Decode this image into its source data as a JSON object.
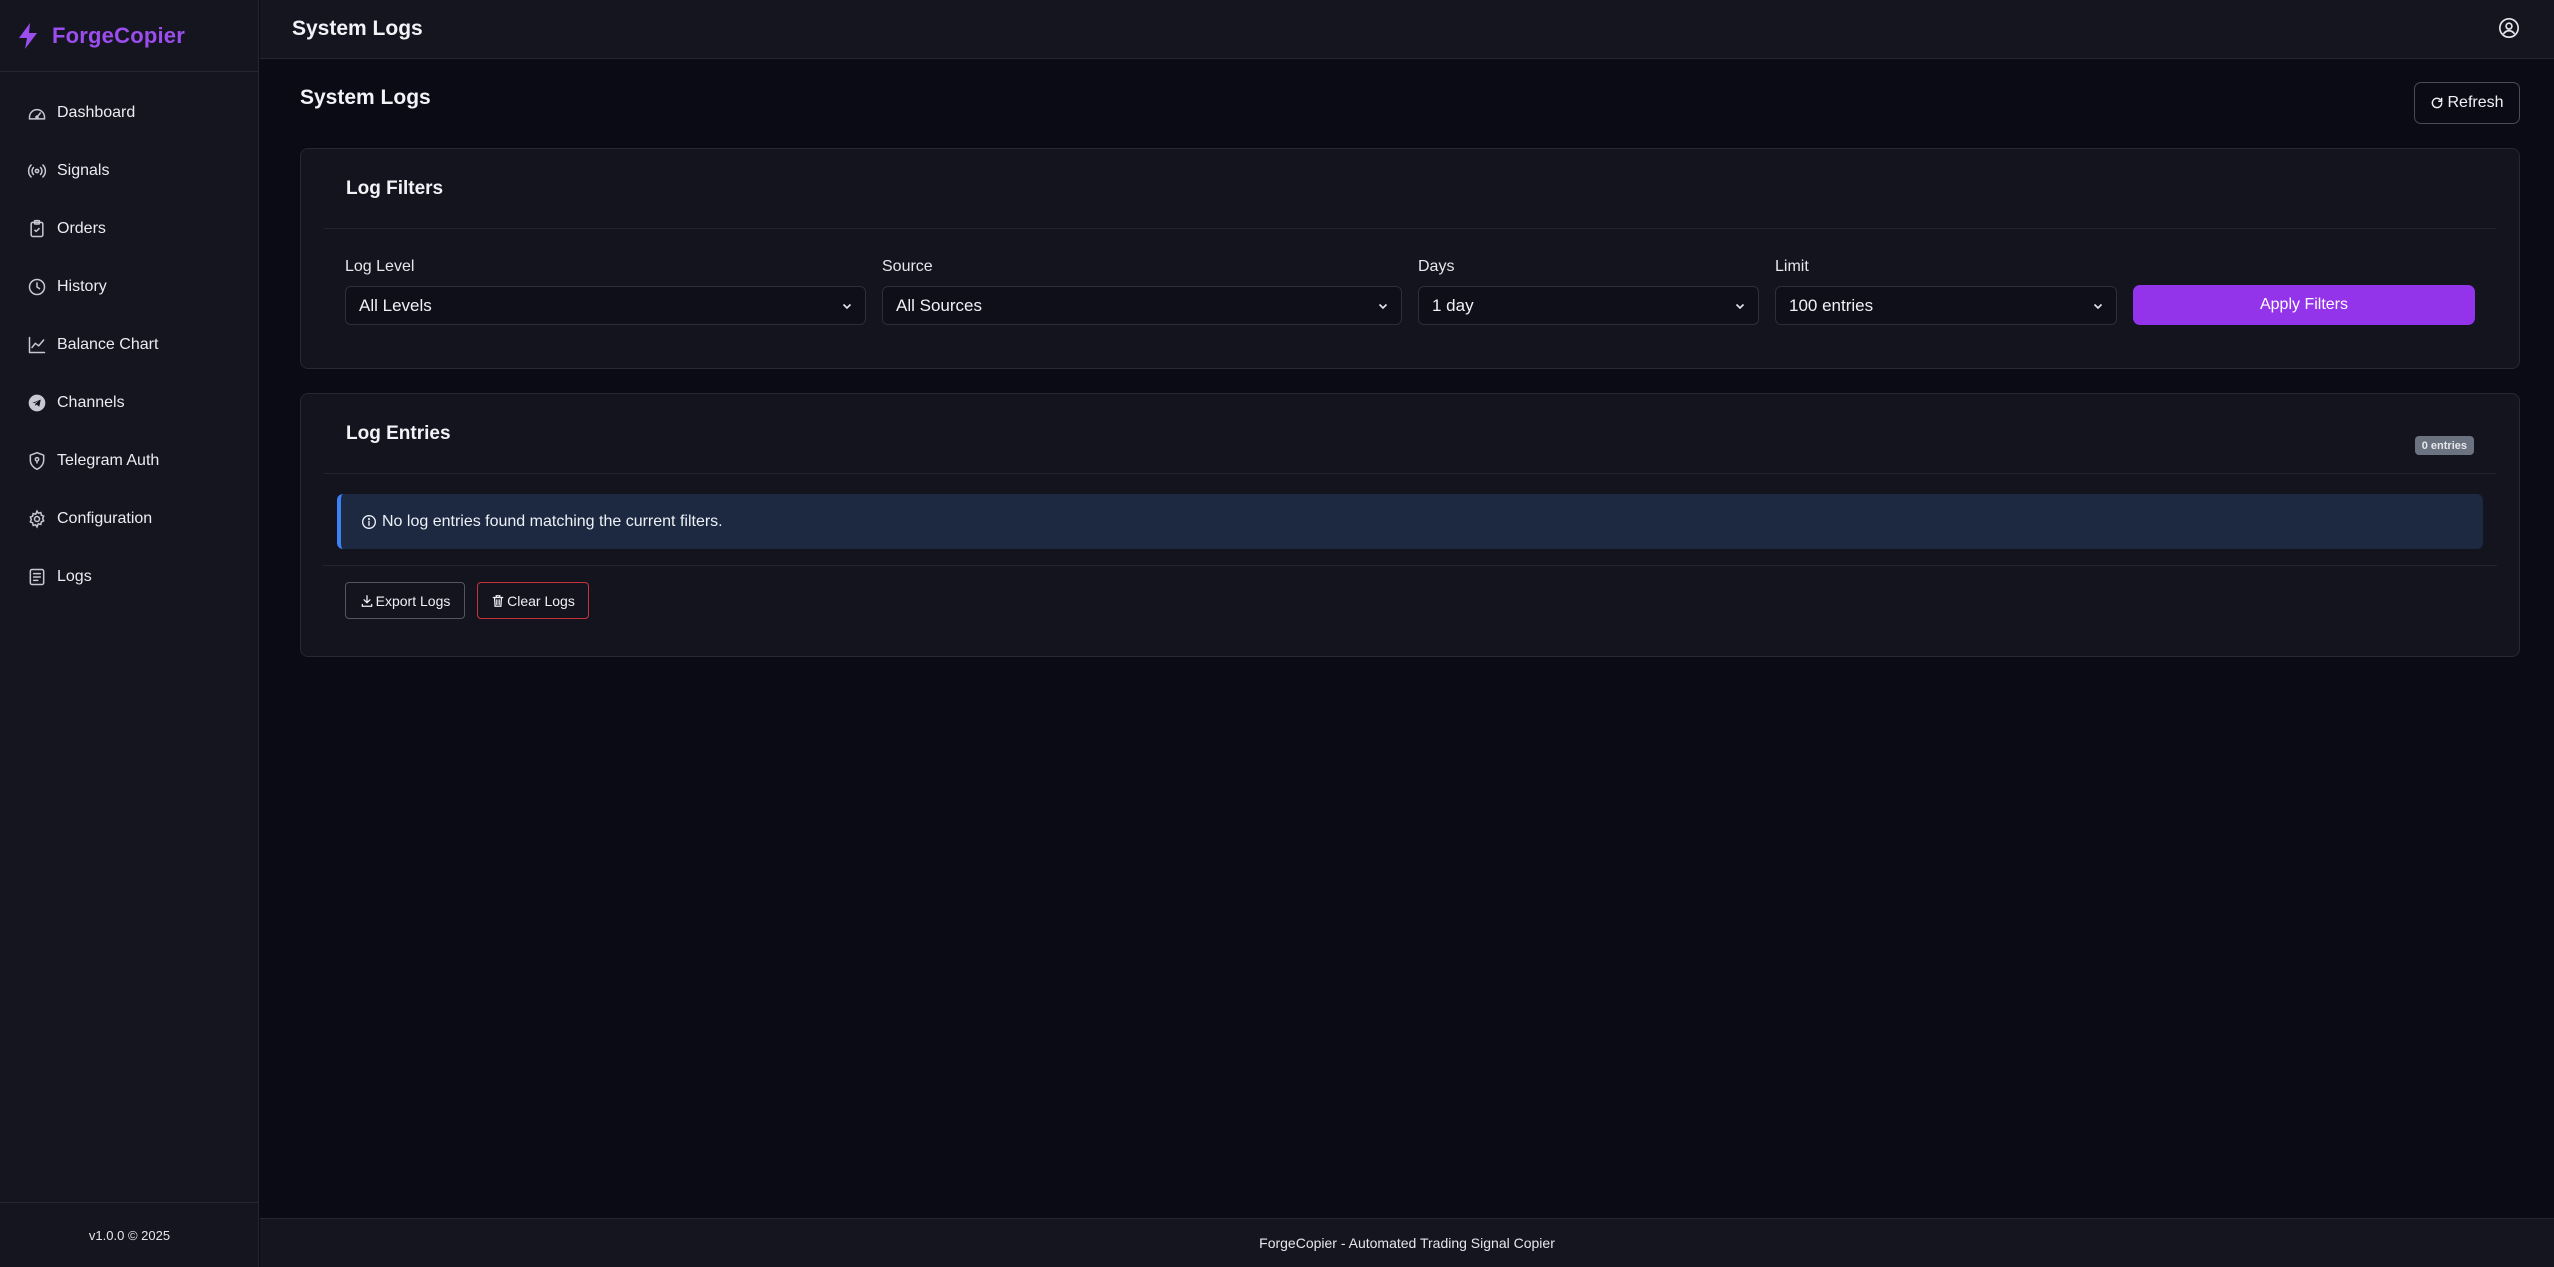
{
  "app": {
    "name": "ForgeCopier",
    "version": "v1.0.0 © 2025",
    "footer": "ForgeCopier - Automated Trading Signal Copier"
  },
  "colors": {
    "accent": "#9333ea",
    "brand": "#9b4dee",
    "info": "#3b82f6",
    "danger": "#c8333b"
  },
  "sidebar": {
    "items": [
      {
        "label": "Dashboard",
        "icon": "dashboard-icon"
      },
      {
        "label": "Signals",
        "icon": "signal-icon"
      },
      {
        "label": "Orders",
        "icon": "clipboard-icon"
      },
      {
        "label": "History",
        "icon": "clock-icon"
      },
      {
        "label": "Balance Chart",
        "icon": "chart-line-icon"
      },
      {
        "label": "Channels",
        "icon": "telegram-icon"
      },
      {
        "label": "Telegram Auth",
        "icon": "shield-icon"
      },
      {
        "label": "Configuration",
        "icon": "gear-icon"
      },
      {
        "label": "Logs",
        "icon": "document-icon"
      }
    ]
  },
  "header": {
    "title": "System Logs"
  },
  "main": {
    "title": "System Logs",
    "refresh_label": "Refresh",
    "filters": {
      "title": "Log Filters",
      "log_level": {
        "label": "Log Level",
        "value": "All Levels"
      },
      "source": {
        "label": "Source",
        "value": "All Sources"
      },
      "days": {
        "label": "Days",
        "value": "1 day"
      },
      "limit": {
        "label": "Limit",
        "value": "100 entries"
      },
      "apply_label": "Apply Filters"
    },
    "entries": {
      "title": "Log Entries",
      "count_badge": "0 entries",
      "empty_message": "No log entries found matching the current filters.",
      "export_label": "Export Logs",
      "clear_label": "Clear Logs"
    }
  }
}
